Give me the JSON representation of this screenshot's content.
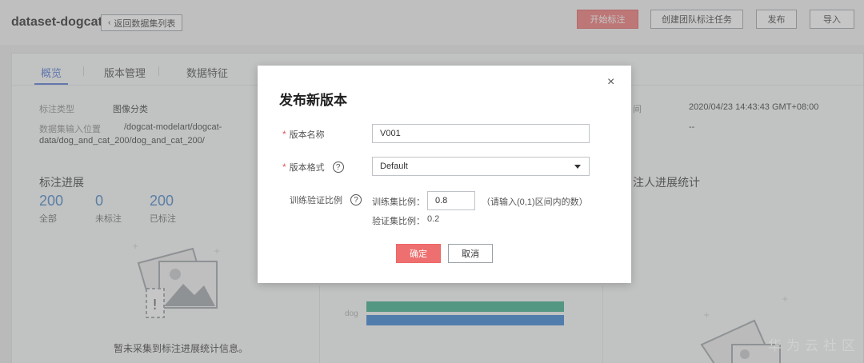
{
  "header": {
    "dataset_name": "dataset-dogcat",
    "back_label": "返回数据集列表",
    "start_label_btn": "开始标注",
    "create_team_task_btn": "创建团队标注任务",
    "publish_btn": "发布",
    "import_btn": "导入"
  },
  "tabs": [
    {
      "label": "概览",
      "active": true
    },
    {
      "label": "版本管理",
      "active": false
    },
    {
      "label": "数据特征",
      "active": false
    }
  ],
  "overview": {
    "label_type_label": "标注类型",
    "label_type_value": "图像分类",
    "input_location_label": "数据集输入位置",
    "input_location_value_line1": "/dogcat-modelart/dogcat-",
    "input_location_value_line2": "data/dog_and_cat_200/dog_and_cat_200/",
    "right_label_partial": "间",
    "created_time": "2020/04/23 14:43:43 GMT+08:00",
    "right_value_2": "--"
  },
  "progress": {
    "title": "标注进展",
    "total_num": "200",
    "total_label": "全部",
    "unlabeled_num": "0",
    "unlabeled_label": "未标注",
    "labeled_num": "200",
    "labeled_label": "已标注",
    "empty_text": "暂未采集到标注进展统计信息。"
  },
  "annotator_stats": {
    "title_partial": "注人进展统计"
  },
  "chart_data": {
    "type": "bar",
    "categories": [
      "dog"
    ],
    "series": [
      {
        "color": "#2fa882"
      },
      {
        "color": "#2b7bd0"
      }
    ]
  },
  "dialog": {
    "title": "发布新版本",
    "close_glyph": "×",
    "version_name_label": "版本名称",
    "version_name_value": "V001",
    "version_format_label": "版本格式",
    "version_format_value": "Default",
    "split_ratio_label": "训练验证比例",
    "train_ratio_label": "训练集比例：",
    "train_ratio_value": "0.8",
    "train_ratio_hint": "（请输入(0,1)区间内的数）",
    "val_ratio_label": "验证集比例：",
    "val_ratio_value": "0.2",
    "ok_label": "确定",
    "cancel_label": "取消"
  },
  "watermark": "华为云社区",
  "colors": {
    "accent": "#ee6f6f",
    "link_blue": "#4a6fd1",
    "stat_blue": "#3b7ec4"
  }
}
